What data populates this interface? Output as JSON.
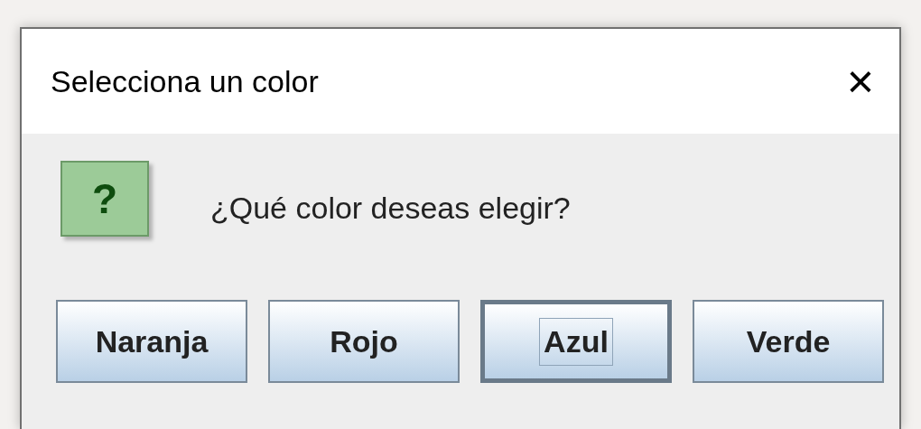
{
  "window": {
    "title": "Selecciona un color",
    "close": "×"
  },
  "message": {
    "icon": "?",
    "text": "¿Qué color deseas elegir?"
  },
  "buttons": [
    {
      "label": "Naranja",
      "focused": false
    },
    {
      "label": "Rojo",
      "focused": false
    },
    {
      "label": "Azul",
      "focused": true
    },
    {
      "label": "Verde",
      "focused": false
    }
  ]
}
